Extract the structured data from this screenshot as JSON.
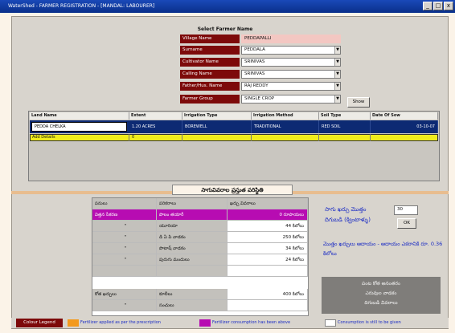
{
  "window": {
    "title": "WaterShed - FARMER REGISTRATION - [MANDAL: LABOURER]",
    "controls": [
      "_",
      "□",
      "x"
    ]
  },
  "form": {
    "header": "Select Farmer Name",
    "fields": [
      {
        "label": "Village Name",
        "value": "PEDDAPALLI"
      },
      {
        "label": "Surname",
        "value": "PEDDALA"
      },
      {
        "label": "Cultivator Name",
        "value": "SRINIVAS"
      },
      {
        "label": "Calling Name",
        "value": "SRINIVAS"
      },
      {
        "label": "Father/Hus. Name",
        "value": "RAJ REDDY"
      },
      {
        "label": "Farmer Group",
        "value": "SINGLE CROP"
      }
    ],
    "show_button": "Show"
  },
  "grid": {
    "columns": [
      "Land Name",
      "Extent",
      "Irrigation Type",
      "Irrigation Method",
      "Soil Type",
      "Date Of Sow"
    ],
    "selected_row": [
      "PEDDA CHELKA",
      "1.20 ACRES",
      "BOREWELL",
      "TRADITIONAL",
      "RED SOIL",
      "03-10-07"
    ],
    "yellow_row": [
      "Add Details",
      "0",
      "",
      "",
      "",
      ""
    ]
  },
  "section": {
    "title": "సాగువివరాల ప్రస్తుత పరిస్థితి"
  },
  "table": {
    "headers": [
      "పనులు",
      "పరికరాలు",
      "ఖర్చు వివరాలు"
    ],
    "rows": [
      [
        "విత్తన సేకరణ",
        "పొలం తయారీ",
        "0 రూపాయలు"
      ],
      [
        "\"",
        "యూరియా",
        "44 కిలోలు"
      ],
      [
        "\"",
        "డి ఏ పి వాడకం",
        "250 కిలోలు"
      ],
      [
        "\"",
        "పొటాష్ వాడకం",
        "34 కిలోలు"
      ],
      [
        "\"",
        "పురుగు మందులు",
        "24 కిలోలు"
      ],
      [
        "",
        "",
        ""
      ],
      [
        "కోత ఖర్చులు",
        "కూలీలు",
        "400 కిలోలు"
      ],
      [
        "\"",
        "సంచులు",
        ""
      ]
    ]
  },
  "side": {
    "label1": "సాగు ఖర్చు మొత్తం",
    "label2": "దిగుబడి (క్వింటాళ్ళు)",
    "input_value": "30",
    "ok_button": "OK",
    "note": "మొత్తం ఖర్చులు ఆదాయం - ఆదాయం ఎకరానికి రూ. 0.36 కిలోలు",
    "dark_box": [
      "పంట కోత అనంతరం",
      "ఎరువుల వాడకం",
      "దిగుబడి వివరాలు"
    ]
  },
  "legend": {
    "title": "Colour Legend",
    "items": [
      {
        "color": "#f39a1e",
        "text": "Fertilizer applied as per the prescription"
      },
      {
        "color": "#b70cb2",
        "text": "Fertilizer consumption has been above"
      },
      {
        "color": "#ffffff",
        "text": "Consumption is still to be given"
      }
    ]
  }
}
